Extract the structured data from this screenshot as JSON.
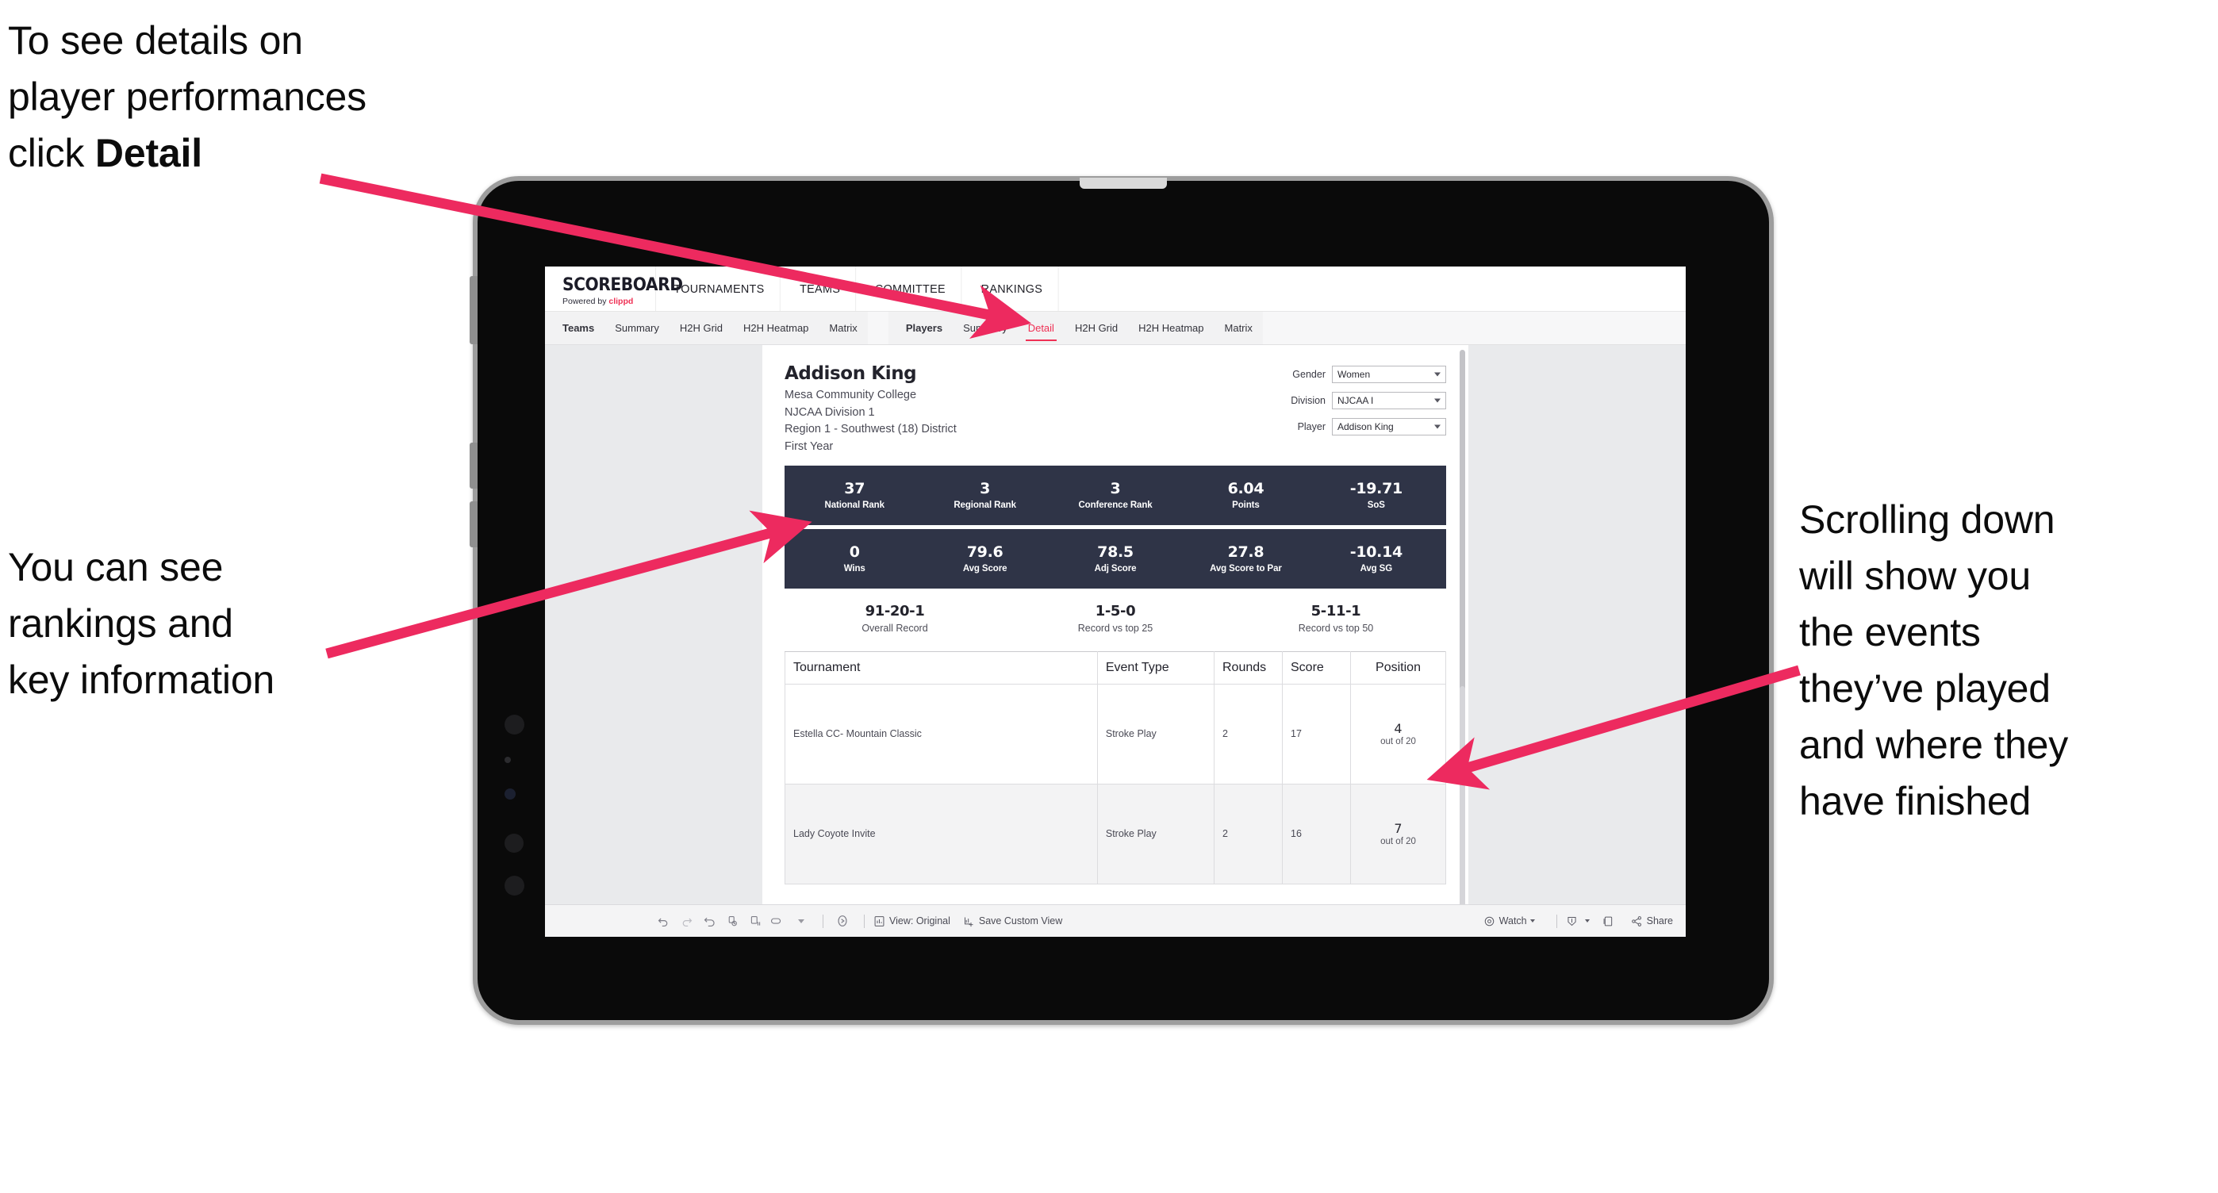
{
  "annotations": {
    "detail": {
      "lines": [
        "To see details on",
        "player performances",
        "click "
      ],
      "bold_word": "Detail"
    },
    "ranking": {
      "lines": [
        "You can see",
        "rankings and",
        "key information"
      ]
    },
    "scrolling": {
      "lines": [
        "Scrolling down",
        "will show you",
        "the events",
        "they’ve played",
        "and where they",
        "have finished"
      ]
    }
  },
  "colors": {
    "accent_pink": "#ED2A5F",
    "brand_red": "#EF3054",
    "stat_bar_navy": "#2F3447",
    "canvas_gray": "#E9EAEC"
  },
  "app": {
    "logo": {
      "word": "SCOREBOARD",
      "powered_prefix": "Powered by ",
      "brand": "clippd"
    },
    "topnav": [
      "TOURNAMENTS",
      "TEAMS",
      "COMMITTEE",
      "RANKINGS"
    ],
    "tabs_group_teams": [
      {
        "label": "Teams",
        "active": false,
        "lead": true
      },
      {
        "label": "Summary",
        "active": false
      },
      {
        "label": "H2H Grid",
        "active": false
      },
      {
        "label": "H2H Heatmap",
        "active": false
      },
      {
        "label": "Matrix",
        "active": false
      }
    ],
    "tabs_group_players": [
      {
        "label": "Players",
        "active": false,
        "lead": true
      },
      {
        "label": "Summary",
        "active": false
      },
      {
        "label": "Detail",
        "active": true
      },
      {
        "label": "H2H Grid",
        "active": false
      },
      {
        "label": "H2H Heatmap",
        "active": false
      },
      {
        "label": "Matrix",
        "active": false
      }
    ]
  },
  "player": {
    "name": "Addison King",
    "meta": [
      "Mesa Community College",
      "NJCAA Division 1",
      "Region 1 - Southwest (18) District",
      "First Year"
    ]
  },
  "filters": [
    {
      "label": "Gender",
      "value": "Women"
    },
    {
      "label": "Division",
      "value": "NJCAA I"
    },
    {
      "label": "Player",
      "value": "Addison King"
    }
  ],
  "stats_row1": [
    {
      "value": "37",
      "label": "National Rank"
    },
    {
      "value": "3",
      "label": "Regional Rank"
    },
    {
      "value": "3",
      "label": "Conference Rank"
    },
    {
      "value": "6.04",
      "label": "Points"
    },
    {
      "value": "-19.71",
      "label": "SoS"
    }
  ],
  "stats_row2": [
    {
      "value": "0",
      "label": "Wins"
    },
    {
      "value": "79.6",
      "label": "Avg Score"
    },
    {
      "value": "78.5",
      "label": "Adj Score"
    },
    {
      "value": "27.8",
      "label": "Avg Score to Par"
    },
    {
      "value": "-10.14",
      "label": "Avg SG"
    }
  ],
  "records": [
    {
      "value": "91-20-1",
      "label": "Overall Record"
    },
    {
      "value": "1-5-0",
      "label": "Record vs top 25"
    },
    {
      "value": "5-11-1",
      "label": "Record vs top 50"
    }
  ],
  "table": {
    "headers": [
      "Tournament",
      "Event Type",
      "Rounds",
      "Score",
      "Position"
    ],
    "rows": [
      {
        "tournament": "Estella CC- Mountain Classic",
        "event_type": "Stroke Play",
        "rounds": "2",
        "score": "17",
        "position": "4",
        "position_of": "out of 20"
      },
      {
        "tournament": "Lady Coyote Invite",
        "event_type": "Stroke Play",
        "rounds": "2",
        "score": "16",
        "position": "7",
        "position_of": "out of 20"
      }
    ]
  },
  "toolbar": {
    "view_label": "View: Original",
    "save_label": "Save Custom View",
    "watch_label": "Watch",
    "share_label": "Share"
  }
}
